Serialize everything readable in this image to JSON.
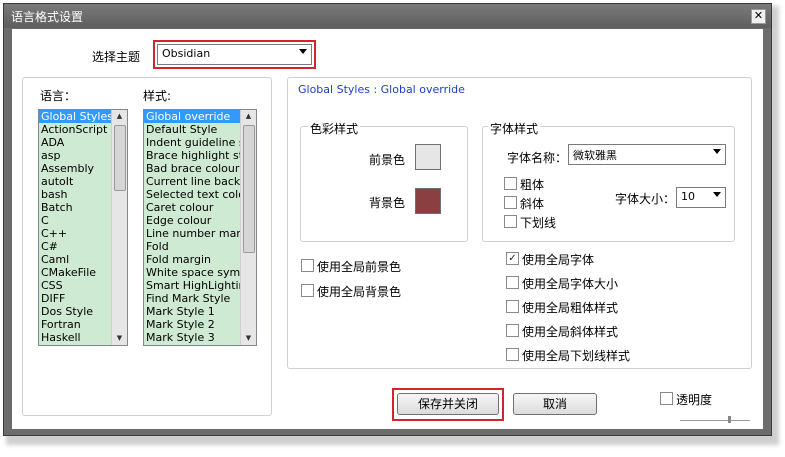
{
  "window": {
    "title": "语言格式设置",
    "close_glyph": "✕"
  },
  "theme": {
    "label": "选择主题",
    "value": "Obsidian"
  },
  "language": {
    "label": "语言：",
    "items": [
      "Global Styles",
      "ActionScript",
      "ADA",
      "asp",
      "Assembly",
      "autoIt",
      "bash",
      "Batch",
      "C",
      "C++",
      "C#",
      "Caml",
      "CMakeFile",
      "CSS",
      "DIFF",
      "Dos Style",
      "Fortran",
      "Haskell"
    ],
    "selected": 0
  },
  "style": {
    "label": "样式:",
    "items": [
      "Global override",
      "Default Style",
      "Indent guideline sty",
      "Brace highlight style",
      "Bad brace colour",
      "Current line backgr",
      "Selected text colou",
      "Caret colour",
      "Edge colour",
      "Line number margin",
      "Fold",
      "Fold margin",
      "White space symbo",
      "Smart HighLighting",
      "Find Mark Style",
      "Mark Style 1",
      "Mark Style 2",
      "Mark Style 3"
    ],
    "selected": 0
  },
  "header": "Global Styles : Global override",
  "color_group": {
    "title": "色彩样式",
    "fg_label": "前景色",
    "fg_color": "#e6e6e6",
    "bg_label": "背景色",
    "bg_color": "#8a3f40"
  },
  "font_group": {
    "title": "字体样式",
    "name_label": "字体名称：",
    "name_value": "微软雅黑",
    "bold": "粗体",
    "italic": "斜体",
    "underline": "下划线",
    "size_label": "字体大小：",
    "size_value": "10"
  },
  "global_checks_left": [
    {
      "label": "使用全局前景色",
      "checked": false
    },
    {
      "label": "使用全局背景色",
      "checked": false
    }
  ],
  "global_checks_right": [
    {
      "label": "使用全局字体",
      "checked": true
    },
    {
      "label": "使用全局字体大小",
      "checked": false
    },
    {
      "label": "使用全局粗体样式",
      "checked": false
    },
    {
      "label": "使用全局斜体样式",
      "checked": false
    },
    {
      "label": "使用全局下划线样式",
      "checked": false
    }
  ],
  "buttons": {
    "save": "保存并关闭",
    "cancel": "取消"
  },
  "transparency": {
    "label": "透明度",
    "checked": false
  },
  "accent": "#d0262b"
}
